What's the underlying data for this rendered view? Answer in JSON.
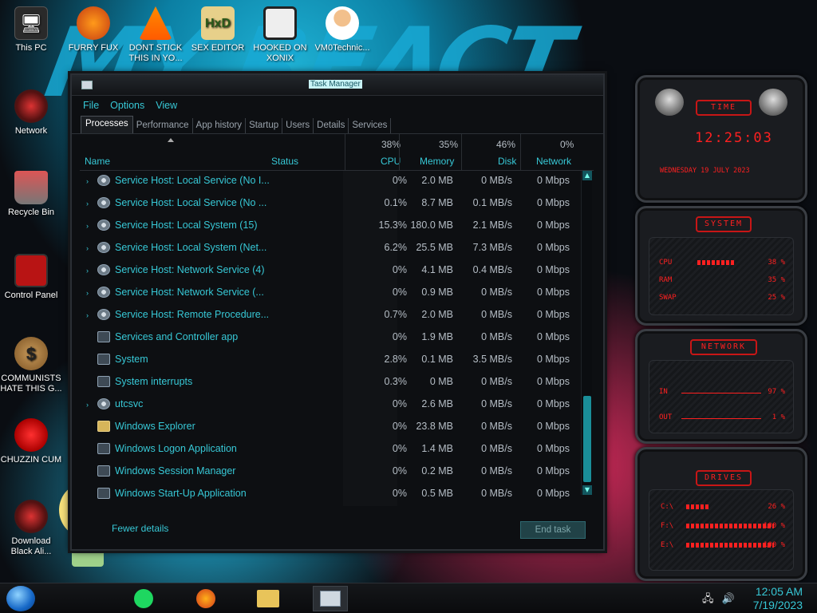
{
  "desktop": {
    "icons": [
      {
        "label": "This PC",
        "icon": "computer-icon"
      },
      {
        "label": "FURRY FUX",
        "icon": "firefox-icon"
      },
      {
        "label": "DONT STICK THIS IN YO...",
        "icon": "vlc-cone-icon"
      },
      {
        "label": "SEX EDITOR",
        "icon": "hxd-editor-icon"
      },
      {
        "label": "HOOKED ON XONIX",
        "icon": "xonix-game-icon"
      },
      {
        "label": "VM0Technic...",
        "icon": "doctor-person-icon"
      },
      {
        "label": "Network",
        "icon": "network-orb-icon"
      },
      {
        "label": "Recycle Bin",
        "icon": "recycle-bin-icon"
      },
      {
        "label": "Control Panel",
        "icon": "control-panel-icon"
      },
      {
        "label": "COMMUNISTS HATE THIS G...",
        "icon": "money-bag-icon"
      },
      {
        "label": "CHUZZIN CUM",
        "icon": "chuzzle-icon"
      },
      {
        "label": "Download Black Ali...",
        "icon": "alien-orb-icon"
      }
    ]
  },
  "task_manager": {
    "title": "Task Manager",
    "menu": [
      "File",
      "Options",
      "View"
    ],
    "tabs": [
      "Processes",
      "Performance",
      "App history",
      "Startup",
      "Users",
      "Details",
      "Services"
    ],
    "active_tab": "Processes",
    "columns": {
      "name": "Name",
      "status": "Status",
      "cpu": {
        "label": "CPU",
        "pct": "38%"
      },
      "memory": {
        "label": "Memory",
        "pct": "35%"
      },
      "disk": {
        "label": "Disk",
        "pct": "46%"
      },
      "network": {
        "label": "Network",
        "pct": "0%"
      }
    },
    "rows": [
      {
        "name": "Service Host: Local Service (No I...",
        "cpu": "0%",
        "memory": "2.0 MB",
        "disk": "0 MB/s",
        "network": "0 Mbps",
        "icon": "gear",
        "expand": true
      },
      {
        "name": "Service Host: Local Service (No ...",
        "cpu": "0.1%",
        "memory": "8.7 MB",
        "disk": "0.1 MB/s",
        "network": "0 Mbps",
        "icon": "gear",
        "expand": true
      },
      {
        "name": "Service Host: Local System (15)",
        "cpu": "15.3%",
        "memory": "180.0 MB",
        "disk": "2.1 MB/s",
        "network": "0 Mbps",
        "icon": "gear",
        "expand": true
      },
      {
        "name": "Service Host: Local System (Net...",
        "cpu": "6.2%",
        "memory": "25.5 MB",
        "disk": "7.3 MB/s",
        "network": "0 Mbps",
        "icon": "gear",
        "expand": true
      },
      {
        "name": "Service Host: Network Service (4)",
        "cpu": "0%",
        "memory": "4.1 MB",
        "disk": "0.4 MB/s",
        "network": "0 Mbps",
        "icon": "gear",
        "expand": true
      },
      {
        "name": "Service Host: Network Service (...",
        "cpu": "0%",
        "memory": "0.9 MB",
        "disk": "0 MB/s",
        "network": "0 Mbps",
        "icon": "gear",
        "expand": true
      },
      {
        "name": "Service Host: Remote Procedure...",
        "cpu": "0.7%",
        "memory": "2.0 MB",
        "disk": "0 MB/s",
        "network": "0 Mbps",
        "icon": "gear",
        "expand": true
      },
      {
        "name": "Services and Controller app",
        "cpu": "0%",
        "memory": "1.9 MB",
        "disk": "0 MB/s",
        "network": "0 Mbps",
        "icon": "window",
        "expand": false
      },
      {
        "name": "System",
        "cpu": "2.8%",
        "memory": "0.1 MB",
        "disk": "3.5 MB/s",
        "network": "0 Mbps",
        "icon": "window",
        "expand": false
      },
      {
        "name": "System interrupts",
        "cpu": "0.3%",
        "memory": "0 MB",
        "disk": "0 MB/s",
        "network": "0 Mbps",
        "icon": "window",
        "expand": false
      },
      {
        "name": "utcsvc",
        "cpu": "0%",
        "memory": "2.6 MB",
        "disk": "0 MB/s",
        "network": "0 Mbps",
        "icon": "gear",
        "expand": true
      },
      {
        "name": "Windows Explorer",
        "cpu": "0%",
        "memory": "23.8 MB",
        "disk": "0 MB/s",
        "network": "0 Mbps",
        "icon": "folder",
        "expand": false
      },
      {
        "name": "Windows Logon Application",
        "cpu": "0%",
        "memory": "1.4 MB",
        "disk": "0 MB/s",
        "network": "0 Mbps",
        "icon": "window",
        "expand": false
      },
      {
        "name": "Windows Session Manager",
        "cpu": "0%",
        "memory": "0.2 MB",
        "disk": "0 MB/s",
        "network": "0 Mbps",
        "icon": "window",
        "expand": false
      },
      {
        "name": "Windows Start-Up Application",
        "cpu": "0%",
        "memory": "0.5 MB",
        "disk": "0 MB/s",
        "network": "0 Mbps",
        "icon": "window",
        "expand": false
      }
    ],
    "footer": {
      "fewer_details": "Fewer details",
      "end_task": "End task"
    }
  },
  "gadgets": {
    "time": {
      "title": "TIME",
      "time": "12:25:03",
      "date": "WEDNESDAY 19 JULY 2023"
    },
    "system": {
      "title": "SYSTEM",
      "cpu_label": "CPU",
      "cpu_value": "38 %",
      "ram_label": "RAM",
      "ram_value": "35 %",
      "swap_label": "SWAP",
      "swap_value": "25 %"
    },
    "network": {
      "title": "NETWORK",
      "in_label": "IN",
      "in_value": "97 %",
      "out_label": "OUT",
      "out_value": "1 %"
    },
    "drives": {
      "title": "DRIVES",
      "items": [
        {
          "label": "C:\\",
          "value": "26 %"
        },
        {
          "label": "F:\\",
          "value": "100 %"
        },
        {
          "label": "E:\\",
          "value": "100 %"
        }
      ]
    }
  },
  "taskbar": {
    "apps": [
      "spotify-icon",
      "firefox-icon",
      "file-explorer-icon",
      "task-manager-icon"
    ],
    "time": "12:05 AM",
    "date": "7/19/2023"
  }
}
